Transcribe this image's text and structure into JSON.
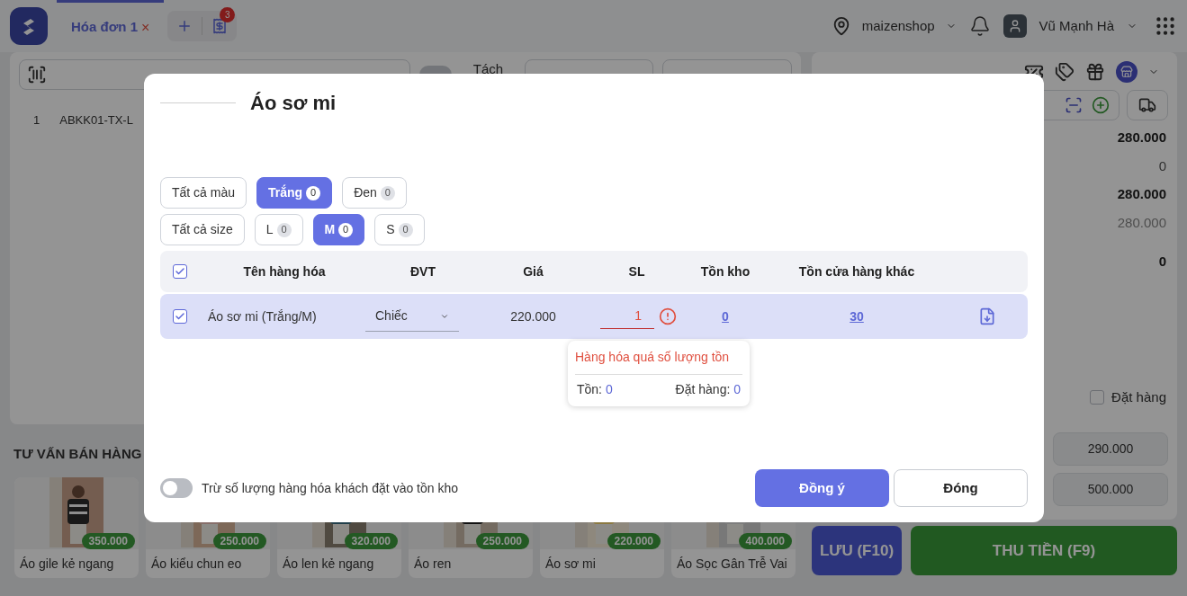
{
  "header": {
    "tabs": [
      {
        "label": "Hóa đơn 1",
        "close": "×",
        "selected": true
      }
    ],
    "receipt_badge": "3",
    "store": "maizenshop",
    "user": "Vũ Mạnh Hà"
  },
  "cart": {
    "split_toggle_on": false,
    "split_label": "Tách",
    "rows": [
      {
        "index": "1",
        "code": "ABKK01-TX-L"
      }
    ]
  },
  "suggestions": {
    "title": "TƯ VẤN BÁN HÀNG",
    "products": [
      {
        "name": "Áo gile kẻ ngang",
        "price": "350.000"
      },
      {
        "name": "Áo kiểu chun eo",
        "price": "250.000"
      },
      {
        "name": "Áo len kẻ ngang",
        "price": "320.000"
      },
      {
        "name": "Áo ren",
        "price": "250.000"
      },
      {
        "name": "Áo sơ mi",
        "price": "220.000"
      },
      {
        "name": "Áo Sọc Gân Trễ Vai",
        "price": "400.000"
      }
    ]
  },
  "summary": {
    "values": [
      {
        "text": "280.000",
        "kind": "subtotal"
      },
      {
        "text": "0",
        "kind": "discount"
      },
      {
        "text": "280.000",
        "kind": "total"
      },
      {
        "text": "280.000",
        "kind": "paid"
      },
      {
        "text": "0",
        "kind": "change"
      }
    ],
    "order_checkbox": {
      "label": "Đặt hàng",
      "checked": false
    },
    "quick_amounts": [
      "290.000",
      "500.000"
    ],
    "save_button": "LƯU (F10)",
    "pay_button": "THU TIỀN (F9)"
  },
  "modal": {
    "title": "Áo sơ mi",
    "color_filters": [
      {
        "label": "Tất cả màu",
        "selected": false
      },
      {
        "label": "Trắng",
        "count": "0",
        "selected": true
      },
      {
        "label": "Đen",
        "count": "0",
        "selected": false
      }
    ],
    "size_filters": [
      {
        "label": "Tất cả size",
        "selected": false
      },
      {
        "label": "L",
        "count": "0",
        "selected": false
      },
      {
        "label": "M",
        "count": "0",
        "selected": true
      },
      {
        "label": "S",
        "count": "0",
        "selected": false
      }
    ],
    "header_checked": true,
    "columns": [
      "Tên hàng hóa",
      "ĐVT",
      "Giá",
      "SL",
      "Tồn kho",
      "Tồn cửa hàng khác"
    ],
    "rows": [
      {
        "checked": true,
        "name": "Áo sơ mi (Trắng/M)",
        "unit": "Chiếc",
        "price": "220.000",
        "qty": "1",
        "qty_error": true,
        "stock": "0",
        "other_stock": "30"
      }
    ],
    "tooltip": {
      "message": "Hàng hóa quá số lượng tồn",
      "stock_label": "Tồn:",
      "stock_value": "0",
      "order_label": "Đặt hàng:",
      "order_value": "0"
    },
    "toggle": {
      "label": "Trừ số lượng hàng hóa khách đặt vào tồn kho",
      "on": false
    },
    "confirm_button": "Đồng ý",
    "close_button": "Đóng"
  }
}
